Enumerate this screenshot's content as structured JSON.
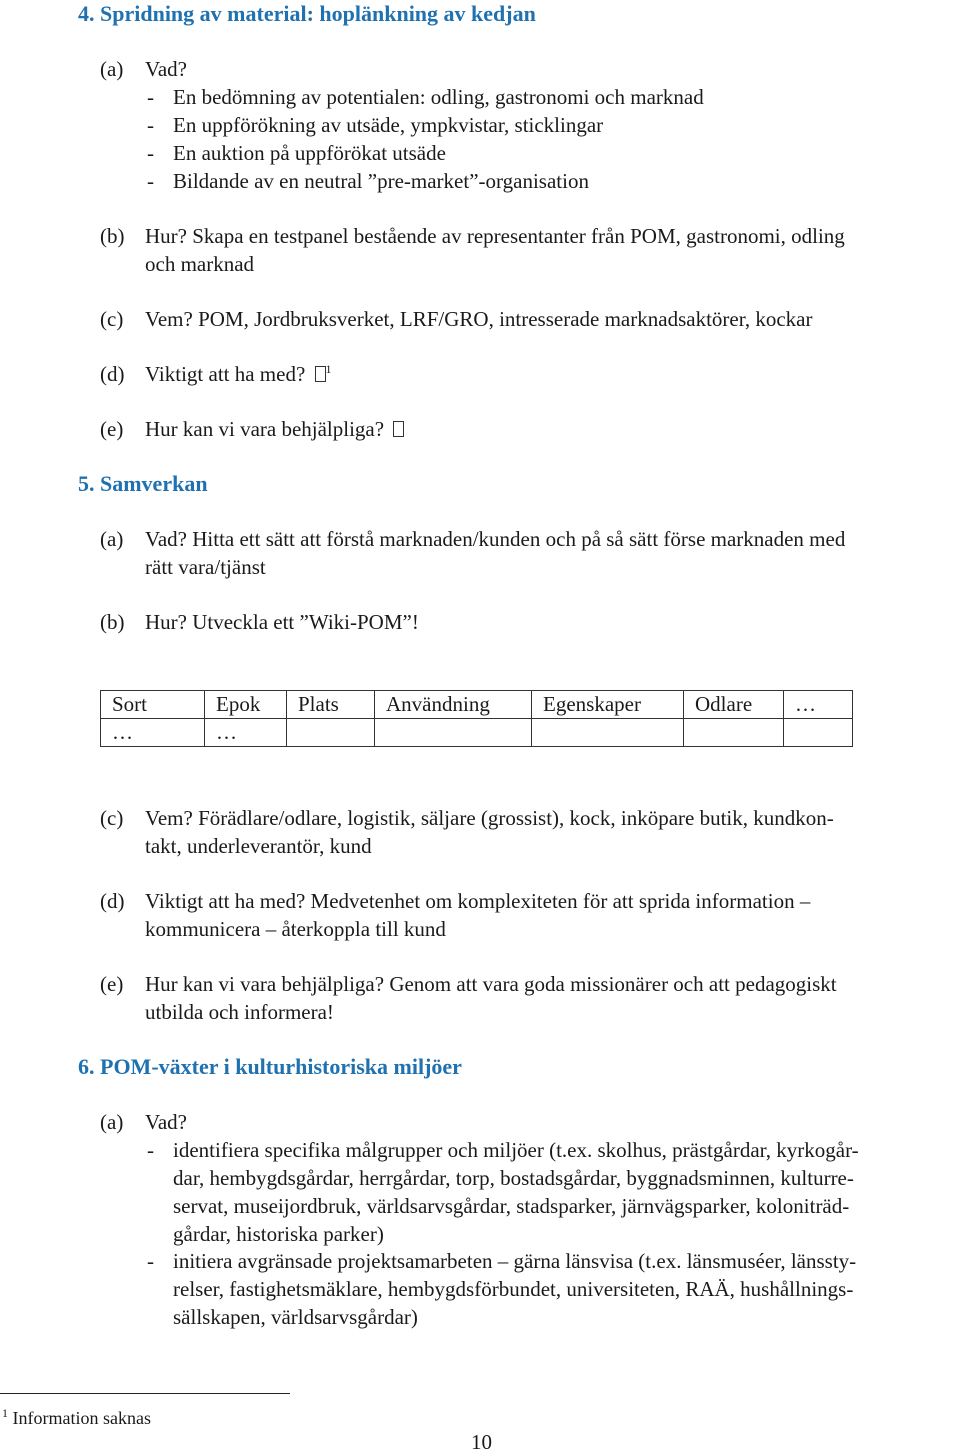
{
  "accent_color": "#2071b0",
  "section4": {
    "heading": "4. Spridning av material: hoplänkning av kedjan",
    "a_label": "(a)",
    "a_title": "Vad?",
    "a_bullets": [
      "En bedömning av potentialen: odling, gastronomi och marknad",
      "En uppförökning av utsäde, ympkvistar, sticklingar",
      "En auktion på uppförökat utsäde",
      "Bildande av en neutral ”pre-market”-organisation"
    ],
    "b_label": "(b)",
    "b_line1": "Hur? Skapa en testpanel bestående av representanter från POM, gastronomi, odling",
    "b_line2": "och marknad",
    "c_label": "(c)",
    "c_text": "Vem? POM, Jordbruksverket, LRF/GRO, intresserade marknadsaktörer, kockar",
    "d_label": "(d)",
    "d_text": "Viktigt att ha med?",
    "d_footnote_ref": "1",
    "e_label": "(e)",
    "e_text": "Hur kan vi vara behjälpliga?"
  },
  "section5": {
    "heading": "5. Samverkan",
    "a_label": "(a)",
    "a_line1": "Vad? Hitta ett sätt att förstå marknaden/kunden och på så sätt förse marknaden med",
    "a_line2": "rätt vara/tjänst",
    "b_label": "(b)",
    "b_text": "Hur? Utveckla ett ”Wiki-POM”!",
    "table": {
      "headers": [
        "Sort",
        "Epok",
        "Plats",
        "Användning",
        "Egenskaper",
        "Odlare",
        "…"
      ],
      "rows": [
        [
          "…",
          "…",
          "",
          "",
          "",
          "",
          ""
        ]
      ]
    },
    "c_label": "(c)",
    "c_line1": "Vem? Förädlare/odlare, logistik, säljare (grossist), kock, inköpare butik, kundkon-",
    "c_line2": "takt, underleverantör, kund",
    "d_label": "(d)",
    "d_line1": "Viktigt att ha med? Medvetenhet om komplexiteten för att sprida information –",
    "d_line2": "kommunicera – återkoppla till kund",
    "e_label": "(e)",
    "e_line1": "Hur kan vi vara behjälpliga? Genom att vara goda missionärer och att pedagogiskt",
    "e_line2": "utbilda och informera!"
  },
  "section6": {
    "heading": "6. POM-växter i kulturhistoriska miljöer",
    "a_label": "(a)",
    "a_title": "Vad?",
    "bullet1_lines": [
      "identifiera specifika målgrupper och miljöer (t.ex. skolhus, prästgårdar, kyrkogår-",
      "dar, hembygdsgårdar, herrgårdar, torp, bostadsgårdar, byggnadsminnen, kulturre-",
      "servat, museijordbruk, världsarvsgårdar, stadsparker, järnvägsparker, koloniträd-",
      "gårdar, historiska parker)"
    ],
    "bullet2_lines": [
      "initiera avgränsade projektsamarbeten – gärna länsvisa (t.ex. länsmuséer, länssty-",
      "relser, fastighetsmäklare, hembygdsförbundet, universiteten, RAÄ, hushållnings-",
      "sällskapen, världsarvsgårdar)"
    ]
  },
  "footnote": {
    "number": "1",
    "text": "Information saknas"
  },
  "page_number": "10",
  "dash": "-"
}
